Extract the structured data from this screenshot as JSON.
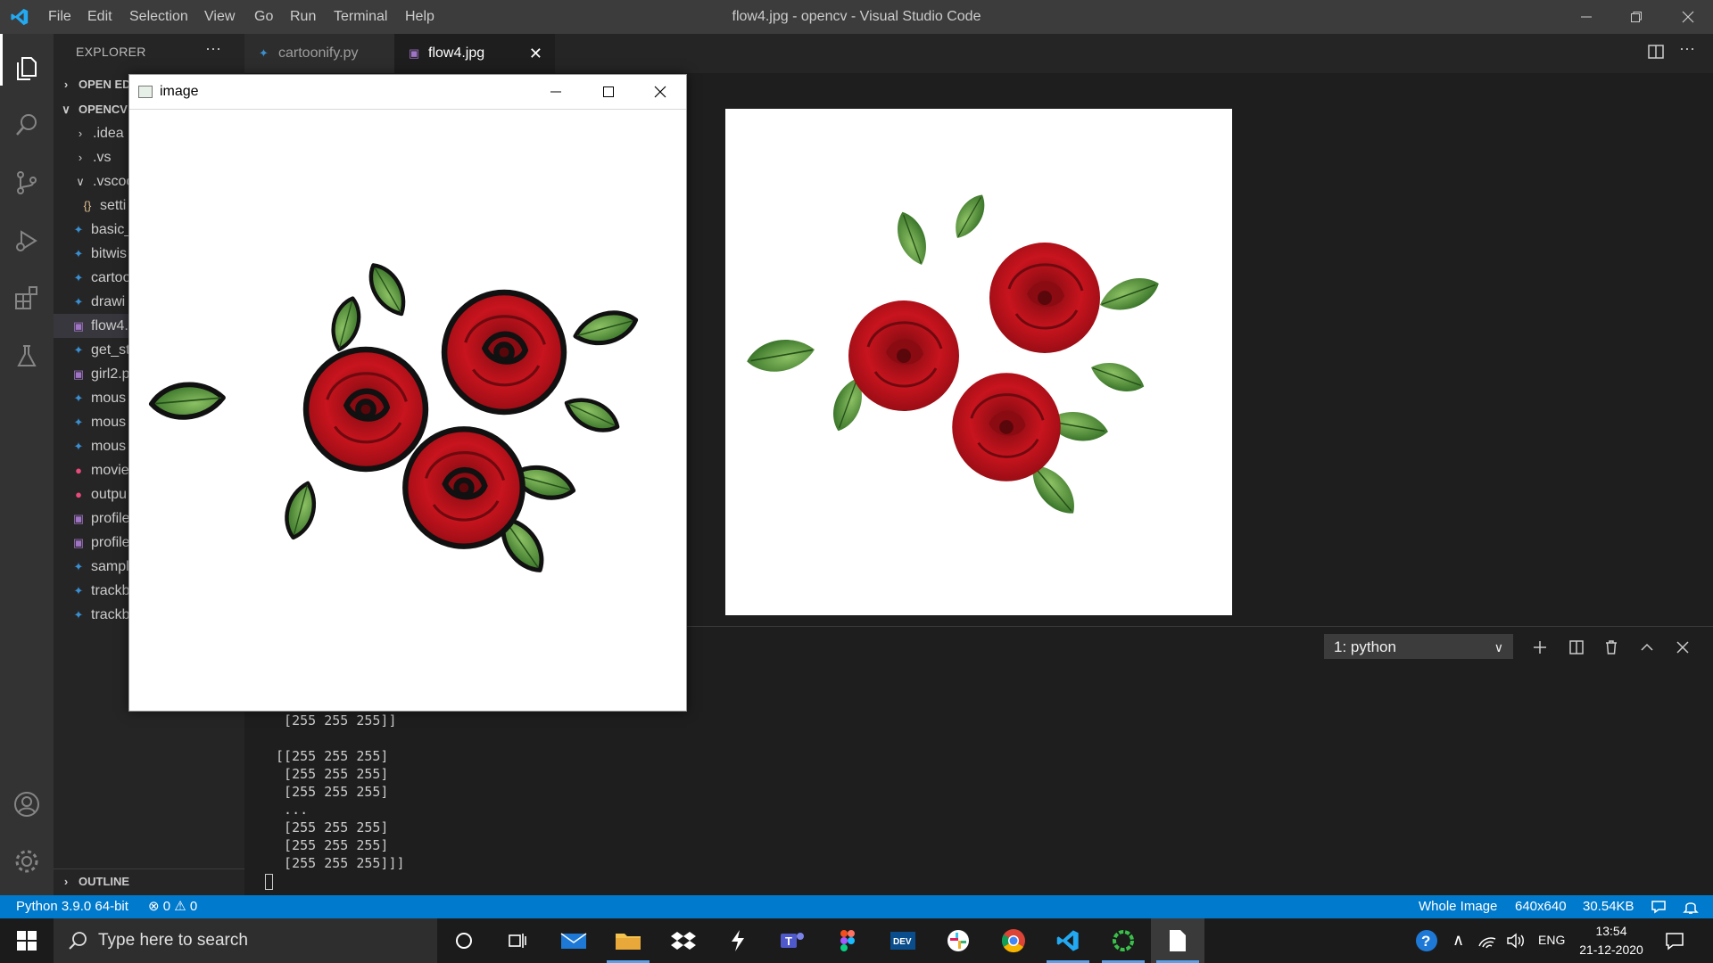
{
  "titlebar": {
    "menus": [
      "File",
      "Edit",
      "Selection",
      "View",
      "Go",
      "Run",
      "Terminal",
      "Help"
    ],
    "window_title": "flow4.jpg - opencv - Visual Studio Code"
  },
  "activitybar": {
    "icons": [
      "explorer-icon",
      "search-icon",
      "source-control-icon",
      "run-debug-icon",
      "extensions-icon",
      "testing-icon",
      "accounts-icon",
      "settings-gear-icon"
    ]
  },
  "sidebar": {
    "title": "EXPLORER",
    "more": "···",
    "open_editors": "OPEN ED",
    "folder": "OPENCV",
    "items": [
      {
        "label": ".idea",
        "type": "folder"
      },
      {
        "label": ".vs",
        "type": "folder"
      },
      {
        "label": ".vscoc",
        "type": "folder-open"
      },
      {
        "label": "setti",
        "type": "json"
      },
      {
        "label": "basic_",
        "type": "python"
      },
      {
        "label": "bitwis",
        "type": "python"
      },
      {
        "label": "cartoo",
        "type": "python"
      },
      {
        "label": "drawi",
        "type": "python"
      },
      {
        "label": "flow4.",
        "type": "image"
      },
      {
        "label": "get_st",
        "type": "python"
      },
      {
        "label": "girl2.p",
        "type": "image"
      },
      {
        "label": "mous",
        "type": "python"
      },
      {
        "label": "mous",
        "type": "python"
      },
      {
        "label": "mous",
        "type": "python"
      },
      {
        "label": "movie",
        "type": "video"
      },
      {
        "label": "outpu",
        "type": "video"
      },
      {
        "label": "profile",
        "type": "image"
      },
      {
        "label": "profile",
        "type": "image"
      },
      {
        "label": "sampl",
        "type": "python"
      },
      {
        "label": "trackb",
        "type": "python"
      },
      {
        "label": "trackb",
        "type": "python"
      }
    ],
    "outline": "OUTLINE"
  },
  "tabs": [
    {
      "label": "cartoonify.py",
      "active": false
    },
    {
      "label": "flow4.jpg",
      "active": true
    }
  ],
  "opencv_window": {
    "title": "image"
  },
  "terminal": {
    "selected": "1: python",
    "lines": [
      "  [255 255 255]]",
      "",
      " [[255 255 255]",
      "  [255 255 255]",
      "  [255 255 255]",
      "  ...",
      "  [255 255 255]",
      "  [255 255 255]",
      "  [255 255 255]]]"
    ]
  },
  "statusbar": {
    "python": "Python 3.9.0 64-bit",
    "errors": "0",
    "warnings": "0",
    "whole_image": "Whole Image",
    "dimensions": "640x640",
    "size": "30.54KB"
  },
  "taskbar": {
    "search_placeholder": "Type here to search",
    "lang": "ENG",
    "time": "13:54",
    "date": "21-12-2020"
  },
  "colors": {
    "accent": "#007acc",
    "rose_red": "#b5121b",
    "leaf_green": "#3f7a2a"
  }
}
